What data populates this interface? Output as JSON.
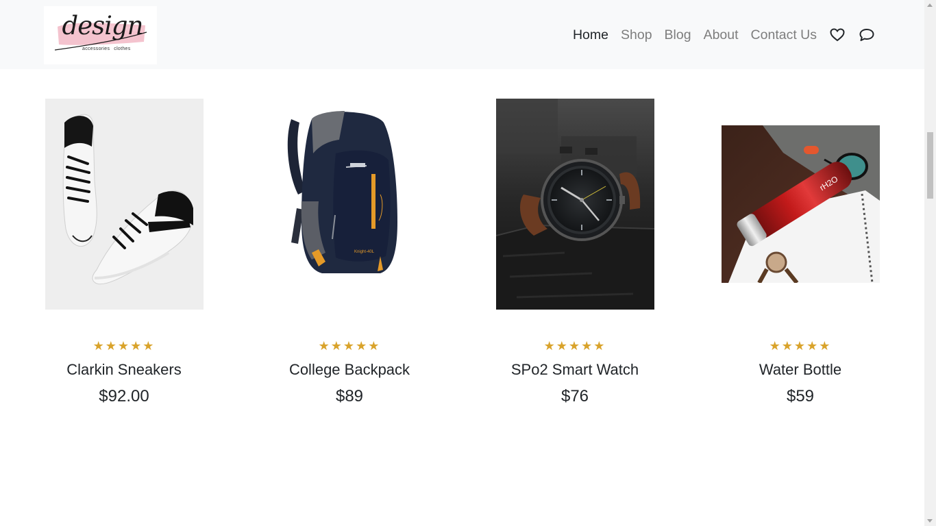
{
  "header": {
    "logo": {
      "word": "design",
      "sub1": "accessories",
      "sub2": "clothes"
    },
    "nav": [
      {
        "label": "Home",
        "active": true
      },
      {
        "label": "Shop",
        "active": false
      },
      {
        "label": "Blog",
        "active": false
      },
      {
        "label": "About",
        "active": false
      },
      {
        "label": "Contact Us",
        "active": false
      }
    ],
    "icons": [
      "heart-icon",
      "chat-icon"
    ]
  },
  "products": [
    {
      "name": "Clarkin Sneakers",
      "price": "$92.00",
      "stars": "★★★★★",
      "rating": 5,
      "image": "sneakers"
    },
    {
      "name": "College Backpack",
      "price": "$89",
      "stars": "★★★★★",
      "rating": 5,
      "image": "backpack"
    },
    {
      "name": "SPo2 Smart Watch",
      "price": "$76",
      "stars": "★★★★★",
      "rating": 5,
      "image": "watch"
    },
    {
      "name": "Water Bottle",
      "price": "$59",
      "stars": "★★★★★",
      "rating": 5,
      "image": "bottle"
    }
  ],
  "colors": {
    "header_bg": "#f8f9fa",
    "star": "#d9a32b",
    "nav_inactive": "#7d7d7d",
    "nav_active": "#212529",
    "logo_brush": "#f2b8c6"
  }
}
